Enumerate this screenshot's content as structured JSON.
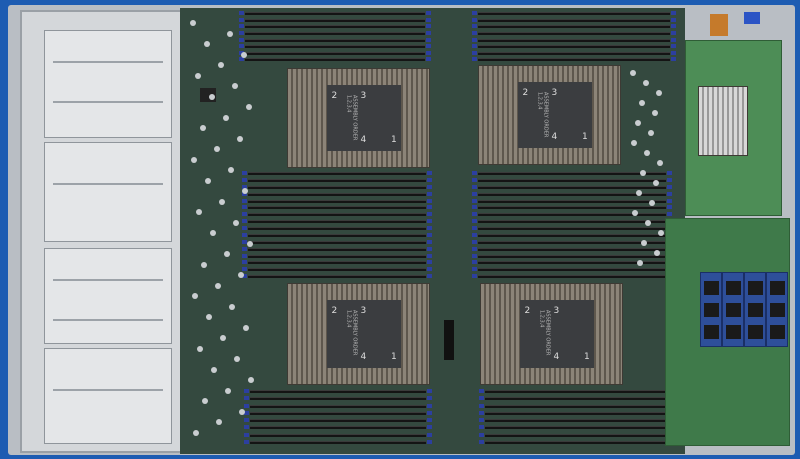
{
  "heatsinks": [
    {
      "label": "ASSEMBLY ORDER 1,2,3,4",
      "n1": "1",
      "n2": "2",
      "n3": "3",
      "n4": "4"
    },
    {
      "label": "ASSEMBLY ORDER 1,2,3,4",
      "n1": "1",
      "n2": "2",
      "n3": "3",
      "n4": "4"
    },
    {
      "label": "ASSEMBLY ORDER 1,2,3,4",
      "n1": "1",
      "n2": "2",
      "n3": "3",
      "n4": "4"
    },
    {
      "label": "ASSEMBLY ORDER 1,2,3,4",
      "n1": "1",
      "n2": "2",
      "n3": "3",
      "n4": "4"
    }
  ],
  "colors": {
    "background": "#1d5cb2",
    "pcb": "#34493f",
    "riser": "#4d8d56"
  }
}
